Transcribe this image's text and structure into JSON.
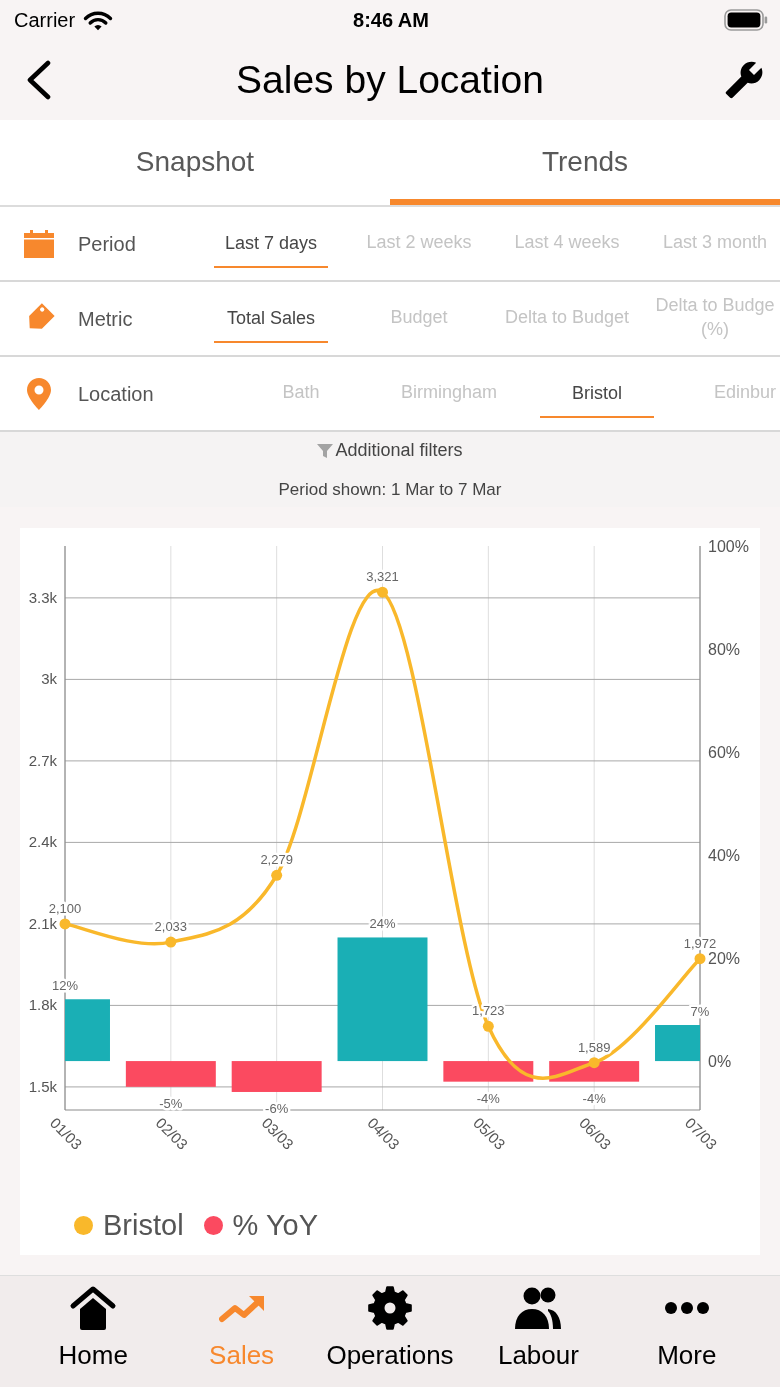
{
  "status_bar": {
    "carrier": "Carrier",
    "time": "8:46 AM"
  },
  "nav_bar": {
    "title": "Sales by Location"
  },
  "tabs": [
    {
      "label": "Snapshot",
      "selected": false
    },
    {
      "label": "Trends",
      "selected": true
    }
  ],
  "filters": [
    {
      "label": "Period",
      "options": [
        {
          "label": "Last 7 days",
          "selected": true
        },
        {
          "label": "Last 2 weeks",
          "selected": false
        },
        {
          "label": "Last 4 weeks",
          "selected": false
        },
        {
          "label": "Last 3 month",
          "selected": false
        }
      ]
    },
    {
      "label": "Metric",
      "options": [
        {
          "label": "Total Sales",
          "selected": true
        },
        {
          "label": "Budget",
          "selected": false
        },
        {
          "label": "Delta to Budget",
          "selected": false
        },
        {
          "label": "Delta to Budge (%)",
          "selected": false
        }
      ]
    },
    {
      "label": "Location",
      "options": [
        {
          "label": "Bath",
          "selected": false
        },
        {
          "label": "Birmingham",
          "selected": false
        },
        {
          "label": "Bristol",
          "selected": true
        },
        {
          "label": "Edinbur",
          "selected": false
        }
      ]
    }
  ],
  "additional_filters": {
    "label": "Additional filters"
  },
  "period_shown": "Period shown: 1 Mar to 7 Mar",
  "chart": {
    "chart_data": {
      "type": "bar",
      "categories": [
        "01/03",
        "02/03",
        "03/03",
        "04/03",
        "05/03",
        "06/03",
        "07/03"
      ],
      "ylim": [
        1415,
        3491
      ],
      "yticks": [
        {
          "value": 1500,
          "label": "1.5k"
        },
        {
          "value": 1800,
          "label": "1.8k"
        },
        {
          "value": 2100,
          "label": "2.1k"
        },
        {
          "value": 2400,
          "label": "2.4k"
        },
        {
          "value": 2700,
          "label": "2.7k"
        },
        {
          "value": 3000,
          "label": "3k"
        },
        {
          "value": 3300,
          "label": "3.3k"
        }
      ],
      "y2lim": [
        -9.5,
        100
      ],
      "y2ticks": [
        {
          "value": 0,
          "label": "0%"
        },
        {
          "value": 20,
          "label": "20%"
        },
        {
          "value": 40,
          "label": "40%"
        },
        {
          "value": 60,
          "label": "60%"
        },
        {
          "value": 80,
          "label": "80%"
        },
        {
          "value": 100,
          "label": "100%"
        }
      ],
      "grid": true,
      "legend": "bottom",
      "data_labels": true,
      "series": [
        {
          "name": "Bristol",
          "type": "line",
          "marker": "circle",
          "color": "#f9b82b",
          "values": [
            2100,
            2033,
            2279,
            3321,
            1723,
            1589,
            1972
          ],
          "value_labels": [
            "2,100",
            "2,033",
            "2,279",
            "3,321",
            "1,723",
            "1,589",
            "1,972"
          ]
        },
        {
          "name": "% YoY",
          "type": "bar",
          "axis": "y2",
          "color": "#fb4a60",
          "colors": [
            "#1aafb5",
            "#fb4a60",
            "#fb4a60",
            "#1aafb5",
            "#fb4a60",
            "#fb4a60",
            "#1aafb5"
          ],
          "values": [
            12,
            -5,
            -6,
            24,
            -4,
            -4,
            7
          ],
          "value_labels": [
            "12%",
            "-5%",
            "-6%",
            "24%",
            "-4%",
            "-4%",
            "7%"
          ]
        }
      ]
    }
  },
  "bottom_tabs": [
    {
      "label": "Home",
      "selected": false
    },
    {
      "label": "Sales",
      "selected": true
    },
    {
      "label": "Operations",
      "selected": false
    },
    {
      "label": "Labour",
      "selected": false
    },
    {
      "label": "More",
      "selected": false
    }
  ]
}
